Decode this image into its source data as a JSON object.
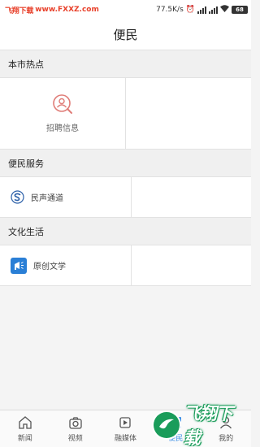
{
  "status_bar": {
    "brand": "飞翔下载",
    "url": "www.FXXZ.com",
    "speed": "77.5K/s",
    "battery": "68"
  },
  "header": {
    "title": "便民"
  },
  "sections": [
    {
      "title": "本市热点",
      "items": [
        {
          "label": "招聘信息",
          "icon": "recruit-search-icon"
        }
      ]
    },
    {
      "title": "便民服务",
      "items": [
        {
          "label": "民声通道",
          "icon": "s-logo-icon"
        }
      ]
    },
    {
      "title": "文化生活",
      "items": [
        {
          "label": "原创文学",
          "icon": "megaphone-icon"
        }
      ]
    }
  ],
  "bottom_nav": {
    "items": [
      {
        "label": "新闻",
        "icon": "home-icon"
      },
      {
        "label": "视频",
        "icon": "camera-icon"
      },
      {
        "label": "融媒体",
        "icon": "media-icon"
      },
      {
        "label": "便民",
        "icon": "service-icon",
        "active": true
      },
      {
        "label": "我的",
        "icon": "user-icon"
      }
    ]
  },
  "watermark": {
    "text": "飞翔下载"
  },
  "colors": {
    "accent": "#3a8ee6",
    "recruit_icon": "#e07d78",
    "brand_red": "#e8402a",
    "watermark_green": "#1a9c5a"
  }
}
